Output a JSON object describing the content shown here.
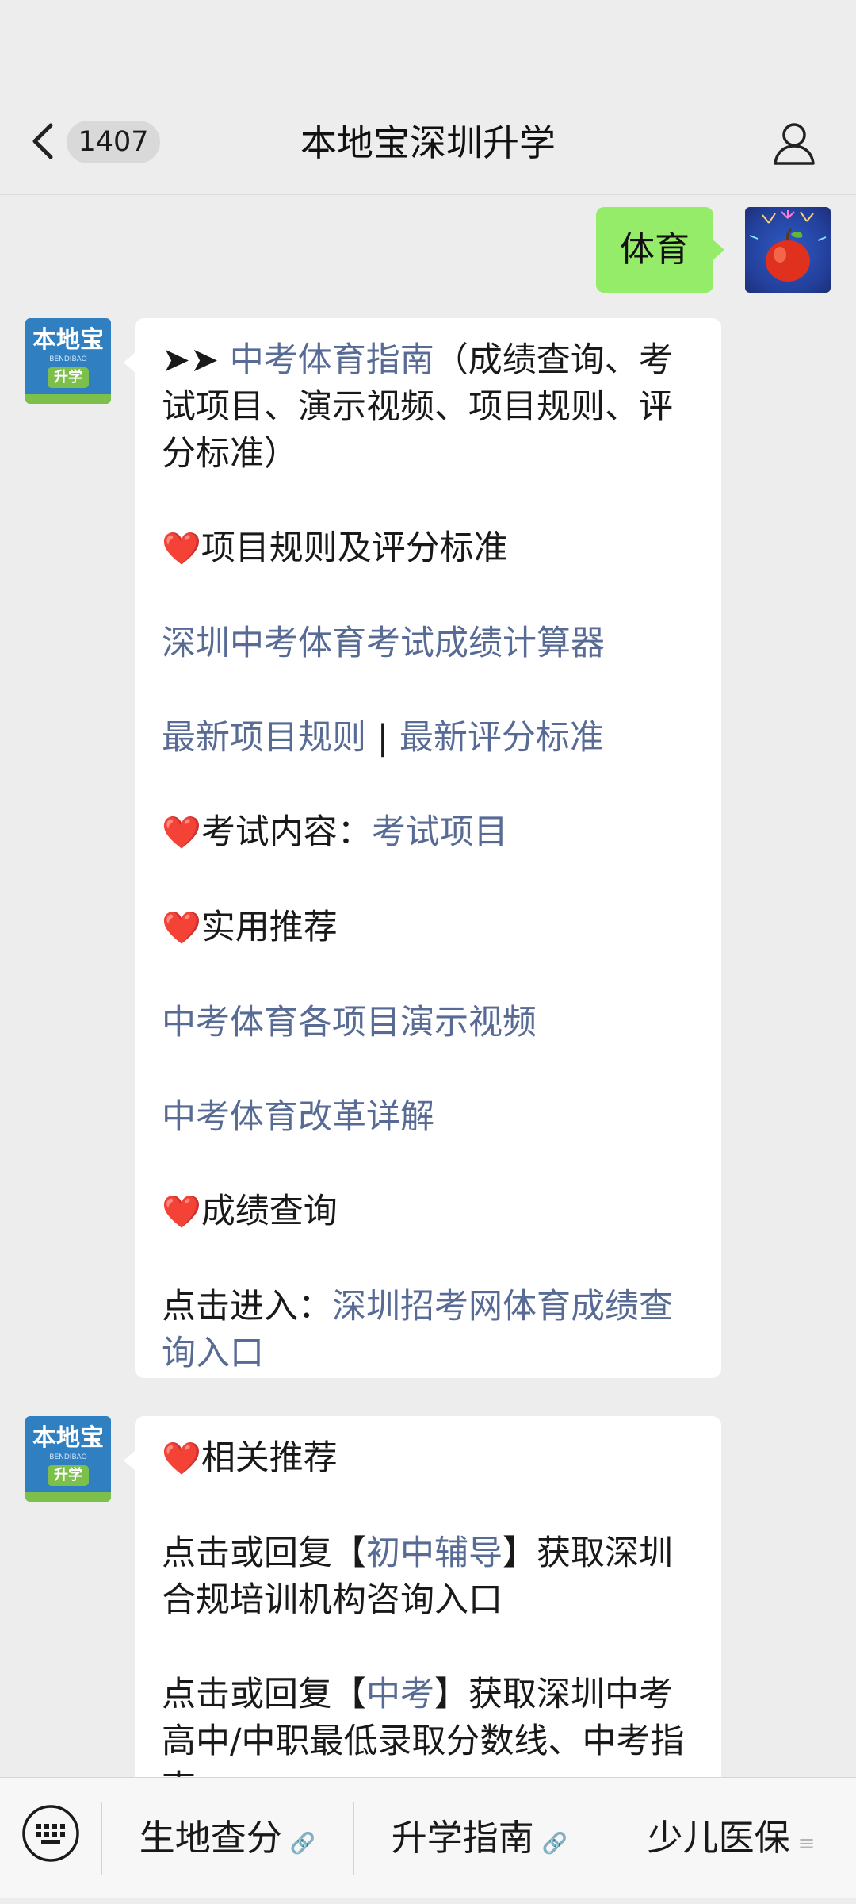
{
  "header": {
    "title": "本地宝深圳升学",
    "unread_count": "1407"
  },
  "brand_avatar": {
    "logo_text": "本地宝",
    "logo_sub": "BENDIBAO",
    "logo_tag": "升学"
  },
  "messages": {
    "me": {
      "text": "体育"
    },
    "bubble1": {
      "line1_prefix": "➤➤ ",
      "line1_link": "中考体育指南",
      "line1_suffix": "（成绩查询、考试项目、演示视频、项目规则、评分标准）",
      "heart1": "❤️",
      "rules_heading": "项目规则及评分标准",
      "calc_link": "深圳中考体育考试成绩计算器",
      "rules_link": "最新项目规则",
      "sep": " | ",
      "score_link": "最新评分标准",
      "heart2": "❤️",
      "content_label": "考试内容：",
      "content_link": "考试项目",
      "heart3": "❤️",
      "recommend_heading": "实用推荐",
      "video_link": "中考体育各项目演示视频",
      "reform_link": "中考体育改革详解",
      "heart4": "❤️",
      "query_heading": "成绩查询",
      "entry_label": "点击进入：",
      "entry_link": "深圳招考网体育成绩查询入口"
    },
    "bubble2": {
      "heart": "❤️",
      "heading": "相关推荐",
      "p1_prefix": "点击或回复【",
      "p1_link": "初中辅导",
      "p1_suffix": "】获取深圳合规培训机构咨询入口",
      "p2_prefix": "点击或回复【",
      "p2_link": "中考",
      "p2_suffix": "】获取深圳中考高中/中职最低录取分数线、中考指南"
    }
  },
  "bottom_menu": {
    "items": [
      {
        "label": "生地查分",
        "suffix": "🔗"
      },
      {
        "label": "升学指南",
        "suffix": "🔗"
      },
      {
        "label": "少儿医保",
        "suffix": "≡"
      }
    ]
  },
  "colors": {
    "link": "#576b95",
    "bubble_me": "#95ec69",
    "background": "#ededed"
  }
}
